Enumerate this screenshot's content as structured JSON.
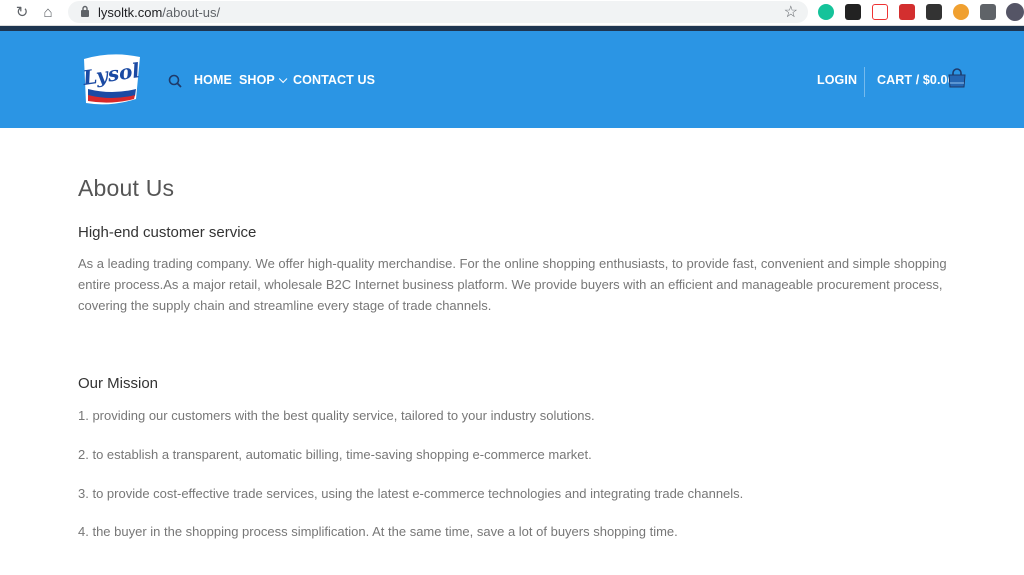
{
  "browser": {
    "url_host": "lysoltk.com",
    "url_path": "/about-us/"
  },
  "header": {
    "logo_text": "Lysol",
    "nav": [
      {
        "label": "HOME"
      },
      {
        "label": "SHOP"
      },
      {
        "label": "CONTACT US"
      }
    ],
    "login_label": "LOGIN",
    "cart_label": "CART / $0.00",
    "brand_color": "#2b95e4"
  },
  "content": {
    "page_title": "About Us",
    "section1": {
      "heading": "High-end customer service",
      "line1": "As a leading trading company. We offer high-quality merchandise. For the online shopping enthusiasts, to provide fast, convenient and simple shopping",
      "line2": "entire process.As a major retail, wholesale B2C Internet business platform. We provide buyers with an efficient and manageable procurement process,",
      "line3": "covering the supply chain and streamline every stage of trade channels."
    },
    "section2": {
      "heading": "Our Mission",
      "items": [
        "1. providing our customers with the best quality service, tailored to your industry solutions.",
        "2. to establish a transparent, automatic billing, time-saving shopping e-commerce market.",
        "3. to provide cost-effective trade services, using the latest e-commerce technologies and integrating trade channels.",
        "4. the buyer in the shopping process simplification. At the same time, save a lot of buyers shopping time."
      ]
    }
  }
}
